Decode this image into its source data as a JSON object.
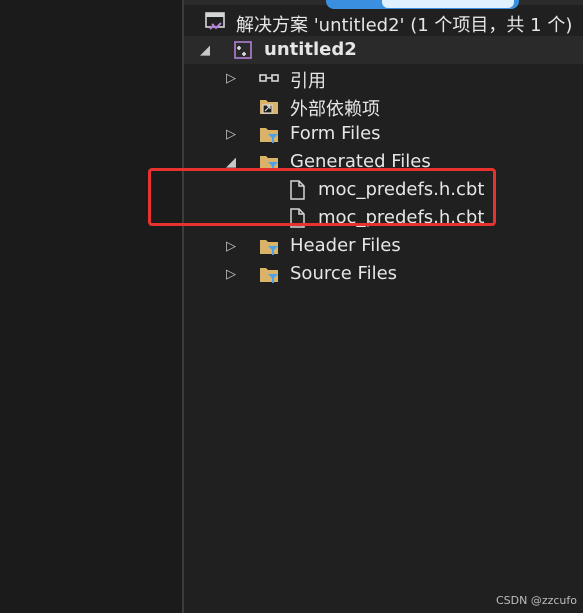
{
  "solution": {
    "label": "解决方案 'untitled2' (1 个项目，共 1 个)"
  },
  "project": {
    "label": "untitled2"
  },
  "tree": {
    "references": "引用",
    "external_deps": "外部依赖项",
    "form_files": "Form Files",
    "generated_files": "Generated Files",
    "generated_children": [
      "moc_predefs.h.cbt",
      "moc_predefs.h.cbt"
    ],
    "header_files": "Header Files",
    "source_files": "Source Files"
  },
  "watermark": "CSDN @zzcufo",
  "colors": {
    "highlight_box": "#e8322f",
    "folder": "#d9b36a",
    "filter": "#4aa3e8",
    "project_icon": "#b180d7"
  }
}
